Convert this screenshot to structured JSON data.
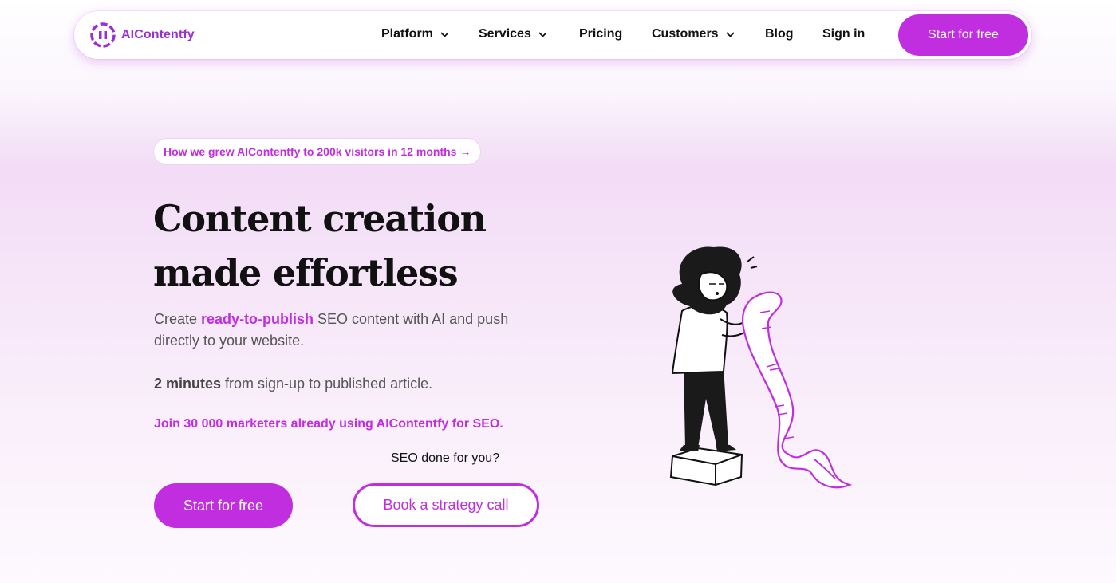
{
  "colors": {
    "accent": "#c02ee0",
    "logo_text": "#9b2fd6",
    "text_dark": "#111111",
    "text_muted": "#555555"
  },
  "brand": {
    "name": "AIContentfy",
    "logo_icon": "aicontentfy-logo-icon"
  },
  "nav": {
    "items": [
      {
        "label": "Platform",
        "has_dropdown": true
      },
      {
        "label": "Services",
        "has_dropdown": true
      },
      {
        "label": "Pricing",
        "has_dropdown": false
      },
      {
        "label": "Customers",
        "has_dropdown": true
      },
      {
        "label": "Blog",
        "has_dropdown": false
      },
      {
        "label": "Sign in",
        "has_dropdown": false
      }
    ],
    "cta_label": "Start for free",
    "dropdown_icon": "chevron-down-icon"
  },
  "hero": {
    "promo_text": "How we grew AIContentfy to 200k visitors in 12 months →",
    "title": "Content creation made effortless",
    "desc_prefix": "Create ",
    "desc_highlight": "ready-to-publish",
    "desc_suffix": " SEO content with AI and push directly to your website.",
    "time_bold": "2 minutes",
    "time_rest": " from sign-up to published article.",
    "join_text": "Join 30 000 marketers already using AIContentfy for SEO.",
    "seo_link": "SEO done for you?",
    "primary_cta": "Start for free",
    "secondary_cta": "Book a strategy call",
    "illustration": "woman-reading-long-scroll-illustration"
  }
}
